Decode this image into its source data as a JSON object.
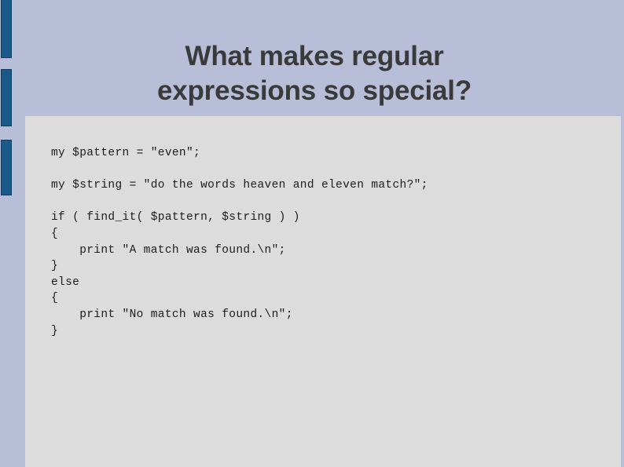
{
  "slide": {
    "title": "What makes regular\nexpressions so special?",
    "background_color": "#b8bdd8",
    "panel_color": "#dcdcdc",
    "accent_color": "#1a5a8a",
    "title_color": "#3a3a3a",
    "code_color": "#1c1c1c"
  },
  "decorations": [
    {
      "name": "blue-bar-1"
    },
    {
      "name": "blue-bar-2"
    },
    {
      "name": "blue-bar-3"
    }
  ],
  "code": {
    "language": "perl",
    "lines": [
      "my $pattern = \"even\";",
      "",
      "my $string = \"do the words heaven and eleven match?\";",
      "",
      "if ( find_it( $pattern, $string ) )",
      "{",
      "    print \"A match was found.\\n\";",
      "}",
      "else",
      "{",
      "    print \"No match was found.\\n\";",
      "}"
    ]
  }
}
